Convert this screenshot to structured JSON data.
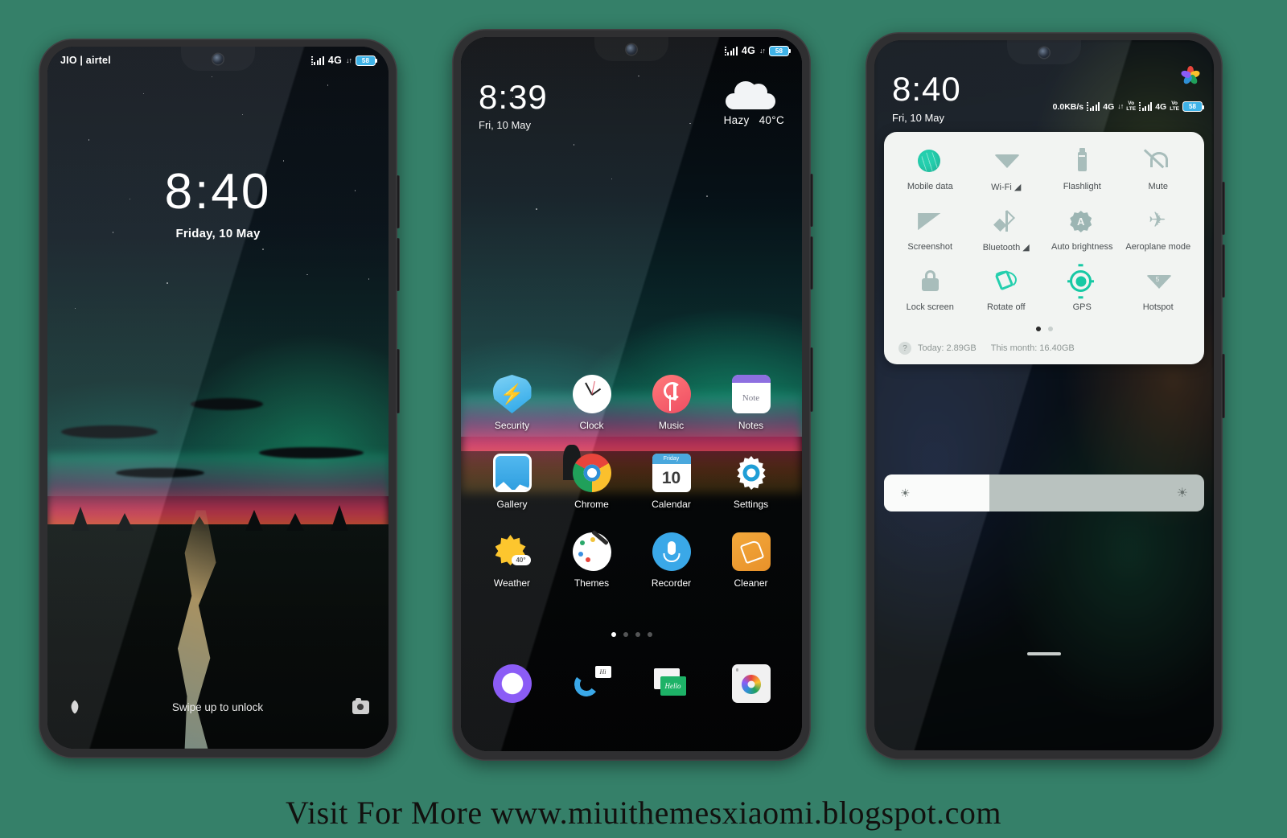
{
  "page": {
    "background_color": "#358069",
    "footer_text": "Visit For More www.miuithemesxiaomi.blogspot.com"
  },
  "phone1_lockscreen": {
    "status_bar": {
      "carrier": "JIO | airtel",
      "network": "4G",
      "battery": "58",
      "signal_icon": "signal-bars-icon",
      "data_arrows_icon": "data-transfer-icon"
    },
    "clock": {
      "time": "8:40",
      "date": "Friday, 10 May"
    },
    "bottom": {
      "left_icon": "flower-shortcut-icon",
      "hint": "Swipe up to unlock",
      "right_icon": "camera-shortcut-icon"
    }
  },
  "phone2_homescreen": {
    "status_bar": {
      "network": "4G",
      "battery": "58"
    },
    "clock": {
      "time": "8:39",
      "date": "Fri, 10 May"
    },
    "weather": {
      "icon": "cloud-icon",
      "condition": "Hazy",
      "temperature": "40°C"
    },
    "apps": [
      {
        "label": "Security",
        "icon": "security-shield-icon"
      },
      {
        "label": "Clock",
        "icon": "clock-icon"
      },
      {
        "label": "Music",
        "icon": "music-note-icon"
      },
      {
        "label": "Notes",
        "icon": "notes-icon",
        "glyph": "Note"
      },
      {
        "label": "Gallery",
        "icon": "gallery-icon"
      },
      {
        "label": "Chrome",
        "icon": "chrome-icon"
      },
      {
        "label": "Calendar",
        "icon": "calendar-icon",
        "day": "10",
        "month": "Friday"
      },
      {
        "label": "Settings",
        "icon": "settings-gear-icon"
      },
      {
        "label": "Weather",
        "icon": "weather-sun-icon",
        "badge": "40°"
      },
      {
        "label": "Themes",
        "icon": "themes-palette-icon"
      },
      {
        "label": "Recorder",
        "icon": "recorder-mic-icon"
      },
      {
        "label": "Cleaner",
        "icon": "cleaner-brush-icon"
      }
    ],
    "page_dots": {
      "count": 4,
      "active_index": 0
    },
    "dock": [
      {
        "label": "Browser",
        "icon": "browser-icon"
      },
      {
        "label": "Phone",
        "icon": "phone-dialer-icon",
        "bubble": "Hi"
      },
      {
        "label": "Messaging",
        "icon": "messaging-icon",
        "bubble": "Hello"
      },
      {
        "label": "Camera",
        "icon": "camera-icon"
      }
    ]
  },
  "phone3_quicksettings": {
    "clock": {
      "time": "8:40",
      "date": "Fri, 10 May"
    },
    "status_bar": {
      "data_speed": "0.0KB/s",
      "sim1_network": "4G",
      "sim1_volte": "VoLTE",
      "sim2_network": "4G",
      "sim2_volte": "VoLTE",
      "battery": "58",
      "notification_icon": "gallery-pinwheel-icon"
    },
    "toggles": [
      {
        "label": "Mobile data",
        "icon": "globe-icon",
        "active": true
      },
      {
        "label": "Wi-Fi",
        "icon": "wifi-icon",
        "active": false,
        "has_caret": true
      },
      {
        "label": "Flashlight",
        "icon": "flashlight-icon",
        "active": false
      },
      {
        "label": "Mute",
        "icon": "bell-mute-icon",
        "active": false
      },
      {
        "label": "Screenshot",
        "icon": "screenshot-icon",
        "active": false
      },
      {
        "label": "Bluetooth",
        "icon": "bluetooth-icon",
        "active": false,
        "has_caret": true
      },
      {
        "label": "Auto brightness",
        "icon": "auto-brightness-icon",
        "active": false
      },
      {
        "label": "Aeroplane mode",
        "icon": "aeroplane-icon",
        "active": false
      },
      {
        "label": "Lock screen",
        "icon": "lock-icon",
        "active": false
      },
      {
        "label": "Rotate off",
        "icon": "rotate-icon",
        "active": true
      },
      {
        "label": "GPS",
        "icon": "gps-icon",
        "active": true
      },
      {
        "label": "Hotspot",
        "icon": "hotspot-icon",
        "active": false
      }
    ],
    "panel_dots": {
      "count": 2,
      "active_index": 0
    },
    "data_usage": {
      "help_icon": "question-mark-icon",
      "today": "Today: 2.89GB",
      "month": "This month: 16.40GB"
    },
    "brightness": {
      "low_icon": "brightness-low-icon",
      "high_icon": "brightness-high-icon",
      "level_percent": 33
    },
    "home_indicator": "home-indicator-bar"
  }
}
